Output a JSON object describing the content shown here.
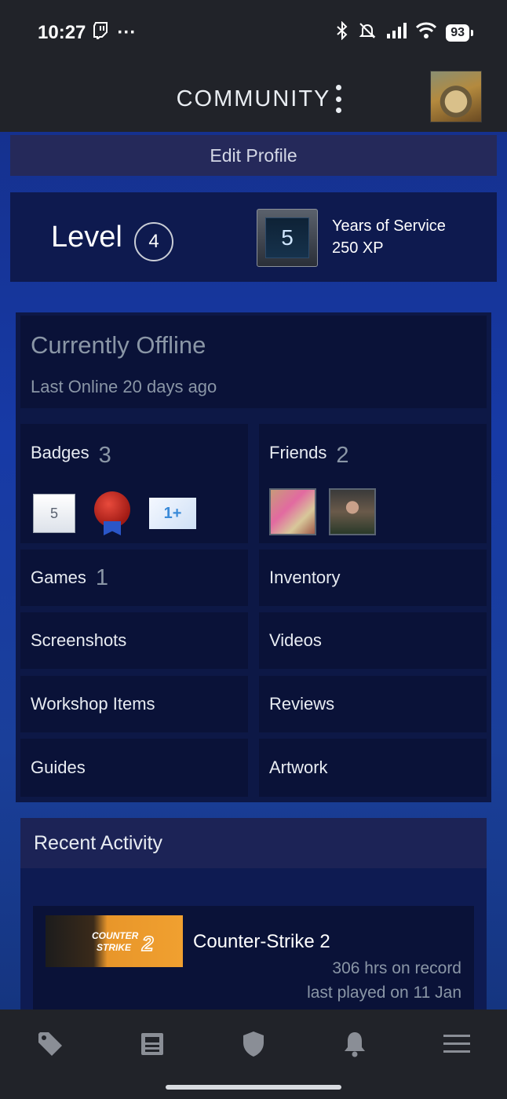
{
  "status_bar": {
    "time": "10:27",
    "dots": "···",
    "battery": "93"
  },
  "header": {
    "title": "COMMUNITY"
  },
  "profile": {
    "edit_label": "Edit Profile",
    "level_label": "Level",
    "level_value": "4",
    "years_badge_value": "5",
    "years_title": "Years of Service",
    "years_xp": "250 XP"
  },
  "status": {
    "title": "Currently Offline",
    "last_online": "Last Online 20 days ago"
  },
  "tiles": {
    "badges": {
      "label": "Badges",
      "count": "3",
      "badge_values": [
        "5",
        "1+"
      ]
    },
    "friends": {
      "label": "Friends",
      "count": "2"
    },
    "games": {
      "label": "Games",
      "count": "1"
    },
    "inventory": {
      "label": "Inventory"
    },
    "screenshots": {
      "label": "Screenshots"
    },
    "videos": {
      "label": "Videos"
    },
    "workshop": {
      "label": "Workshop Items"
    },
    "reviews": {
      "label": "Reviews"
    },
    "guides": {
      "label": "Guides"
    },
    "artwork": {
      "label": "Artwork"
    }
  },
  "recent": {
    "header": "Recent Activity",
    "game": {
      "name": "Counter-Strike 2",
      "hours": "306 hrs on record",
      "last_played": "last played on 11 Jan"
    }
  },
  "colors": {
    "accent_blue": "#173aa6",
    "panel_dark": "#0a1238",
    "muted_text": "#8a96a6"
  },
  "icons": {
    "nav": [
      "tag-icon",
      "news-icon",
      "shield-icon",
      "bell-icon",
      "menu-icon"
    ]
  }
}
